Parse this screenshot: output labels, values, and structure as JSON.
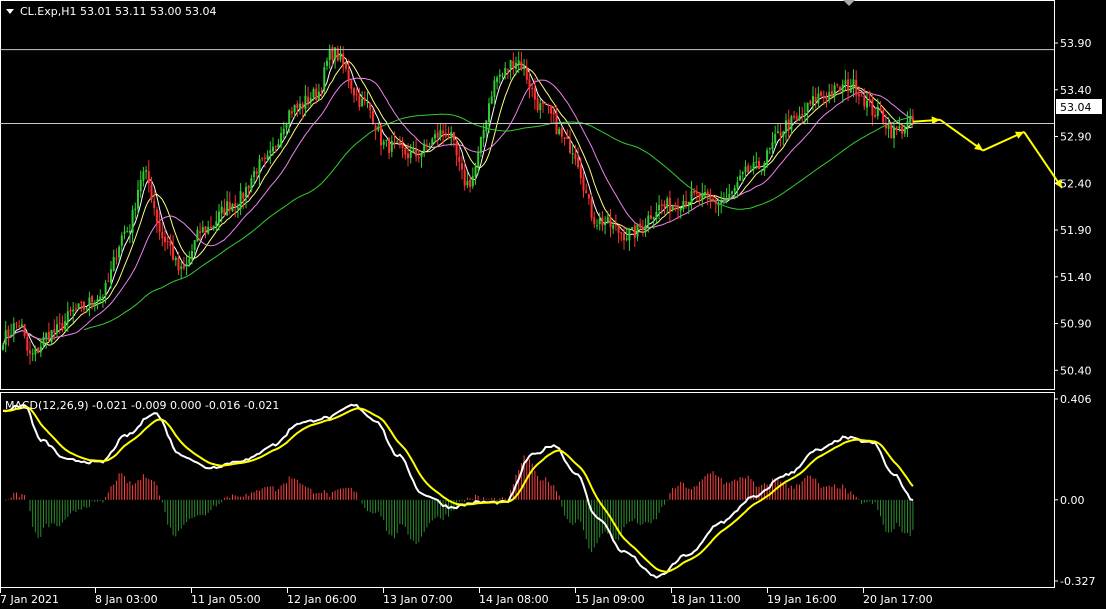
{
  "header": {
    "symbol_line": "CL.Exp,H1  53.01 53.11 53.00 53.04",
    "macd_line": "MACD(12,26,9) -0.021 -0.009 0.000 -0.016 -0.021"
  },
  "price_badge": "53.04",
  "chart_data": [
    {
      "type": "candlestick",
      "title": "CL.Exp,H1",
      "ylim": [
        50.2,
        54.05
      ],
      "yticks": [
        "53.90",
        "53.40",
        "52.90",
        "52.40",
        "51.90",
        "51.40",
        "50.90",
        "50.40"
      ],
      "xticks": [
        "7 Jan 2021",
        "8 Jan 03:00",
        "11 Jan 05:00",
        "12 Jan 06:00",
        "13 Jan 07:00",
        "14 Jan 08:00",
        "15 Jan 09:00",
        "18 Jan 11:00",
        "19 Jan 16:00",
        "20 Jan 17:00"
      ],
      "current_price": 53.04,
      "high_line": 53.83,
      "anchors": [
        [
          0,
          50.75
        ],
        [
          6,
          50.9
        ],
        [
          10,
          50.55
        ],
        [
          18,
          50.8
        ],
        [
          28,
          51.05
        ],
        [
          36,
          51.2
        ],
        [
          46,
          51.9
        ],
        [
          52,
          52.5
        ],
        [
          60,
          51.8
        ],
        [
          66,
          51.45
        ],
        [
          74,
          51.9
        ],
        [
          86,
          52.2
        ],
        [
          96,
          52.6
        ],
        [
          108,
          53.2
        ],
        [
          116,
          53.35
        ],
        [
          122,
          53.8
        ],
        [
          134,
          53.25
        ],
        [
          142,
          52.8
        ],
        [
          152,
          52.7
        ],
        [
          164,
          52.95
        ],
        [
          172,
          52.4
        ],
        [
          184,
          53.55
        ],
        [
          190,
          53.72
        ],
        [
          200,
          53.2
        ],
        [
          210,
          52.8
        ],
        [
          220,
          52.0
        ],
        [
          232,
          51.85
        ],
        [
          244,
          52.15
        ],
        [
          256,
          52.25
        ],
        [
          266,
          52.2
        ],
        [
          278,
          52.55
        ],
        [
          292,
          53.05
        ],
        [
          304,
          53.35
        ],
        [
          314,
          53.45
        ],
        [
          324,
          53.15
        ],
        [
          330,
          52.95
        ],
        [
          337,
          53.05
        ]
      ],
      "n_candles": 338,
      "moving_averages": [
        {
          "period": 5,
          "color": "#ffffff"
        },
        {
          "period": 10,
          "color": "#ffff80"
        },
        {
          "period": 20,
          "color": "#ee82ee"
        },
        {
          "period": 60,
          "color": "#32cd32"
        }
      ],
      "up_color": "#32cd32",
      "down_color": "#ff3030",
      "forecast": {
        "color": "#ffff00",
        "points": [
          [
            345,
            53.08
          ],
          [
            360,
            52.75
          ],
          [
            380,
            52.95
          ],
          [
            400,
            52.35
          ]
        ]
      }
    },
    {
      "type": "macd",
      "ylim": [
        -0.327,
        0.406
      ],
      "yticks": [
        "0.406",
        "0.00",
        "-0.327"
      ],
      "macd_anchors": [
        [
          0,
          0.36
        ],
        [
          8,
          0.38
        ],
        [
          14,
          0.24
        ],
        [
          24,
          0.16
        ],
        [
          36,
          0.15
        ],
        [
          46,
          0.26
        ],
        [
          56,
          0.35
        ],
        [
          66,
          0.18
        ],
        [
          76,
          0.13
        ],
        [
          90,
          0.16
        ],
        [
          100,
          0.22
        ],
        [
          110,
          0.31
        ],
        [
          120,
          0.33
        ],
        [
          130,
          0.38
        ],
        [
          138,
          0.32
        ],
        [
          146,
          0.18
        ],
        [
          156,
          0.02
        ],
        [
          166,
          -0.03
        ],
        [
          176,
          -0.01
        ],
        [
          186,
          -0.01
        ],
        [
          196,
          0.18
        ],
        [
          204,
          0.22
        ],
        [
          212,
          0.11
        ],
        [
          220,
          -0.07
        ],
        [
          230,
          -0.21
        ],
        [
          242,
          -0.31
        ],
        [
          254,
          -0.22
        ],
        [
          266,
          -0.09
        ],
        [
          278,
          0.01
        ],
        [
          290,
          0.1
        ],
        [
          302,
          0.2
        ],
        [
          312,
          0.25
        ],
        [
          322,
          0.23
        ],
        [
          330,
          0.1
        ],
        [
          337,
          0.0
        ]
      ],
      "signal_period": 9,
      "macd_color": "#ffffff",
      "signal_color": "#ffff00",
      "hist_up_color": "#ff4040",
      "hist_down_color": "#2e8b2e"
    }
  ]
}
